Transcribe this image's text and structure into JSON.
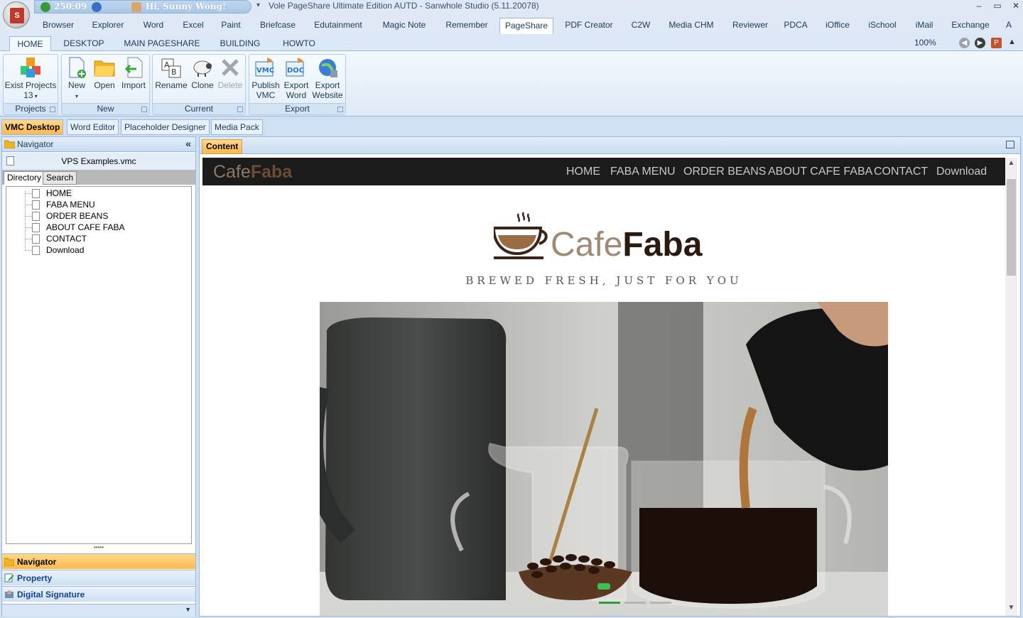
{
  "titlebar": {
    "counter": "250:09",
    "greeting": "Hi, Sunny Wong!",
    "window_title": "Vole PageShare Ultimate Edition AUTD - Sanwhole Studio (5.11.20078)",
    "minimize": "–",
    "maximize": "▭",
    "close": "✕"
  },
  "app_tabs": [
    "Browser",
    "Explorer",
    "Word",
    "Excel",
    "Paint",
    "Briefcase",
    "Edutainment",
    "Magic Note",
    "Remember",
    "PageShare",
    "PDF Creator",
    "C2W",
    "Media CHM",
    "Reviewer",
    "PDCA",
    "iOffice",
    "iSchool",
    "iMail",
    "Exchange",
    "A"
  ],
  "active_app_tab": "PageShare",
  "ribbon": {
    "tabs": [
      "HOME",
      "DESKTOP",
      "MAIN PAGESHARE",
      "BUILDING",
      "HOWTO"
    ],
    "active_tab": "HOME",
    "zoom": "100%",
    "groups": {
      "projects": {
        "label": "Projects",
        "exist_projects": "Exist Projects",
        "count": "13"
      },
      "new": {
        "label": "New",
        "new": "New",
        "open": "Open",
        "import": "Import"
      },
      "current": {
        "label": "Current",
        "rename": "Rename",
        "clone": "Clone",
        "delete": "Delete"
      },
      "export": {
        "label": "Export",
        "publish_vmc_1": "Publish",
        "publish_vmc_2": "VMC",
        "export_word_1": "Export",
        "export_word_2": "Word",
        "export_website_1": "Export",
        "export_website_2": "Website"
      }
    },
    "icon_text": {
      "vmc": "VMC",
      "doc": "DOC"
    }
  },
  "doc_tabs": [
    "VMC Desktop",
    "Word Editor",
    "Placeholder Designer",
    "Media Pack"
  ],
  "navigator": {
    "title": "Navigator",
    "collapse": "«",
    "file": "VPS Examples.vmc",
    "subtabs": [
      "Directory",
      "Search"
    ],
    "tree": [
      "HOME",
      "FABA MENU",
      "ORDER BEANS",
      "ABOUT CAFE FABA",
      "CONTACT",
      "Download"
    ],
    "splitter": "•••••",
    "accordion": [
      "Navigator",
      "Property",
      "Digital Signature"
    ],
    "footer_arrow": "▼"
  },
  "content": {
    "tab": "Content",
    "site": {
      "logo_a": "Cafe",
      "logo_b": "Faba",
      "nav": [
        "HOME",
        "FABA MENU",
        "ORDER BEANS",
        "ABOUT CAFE FABA",
        "CONTACT",
        "Download"
      ],
      "brand_a": "Cafe",
      "brand_b": "Faba",
      "tagline": "BREWED FRESH, JUST FOR YOU"
    }
  },
  "colors": {
    "accent_orange": "#ffb84d",
    "ribbon_blue": "#dce8f5",
    "coffee_brown": "#6b4a36",
    "carousel_active": "#2e9e45"
  }
}
